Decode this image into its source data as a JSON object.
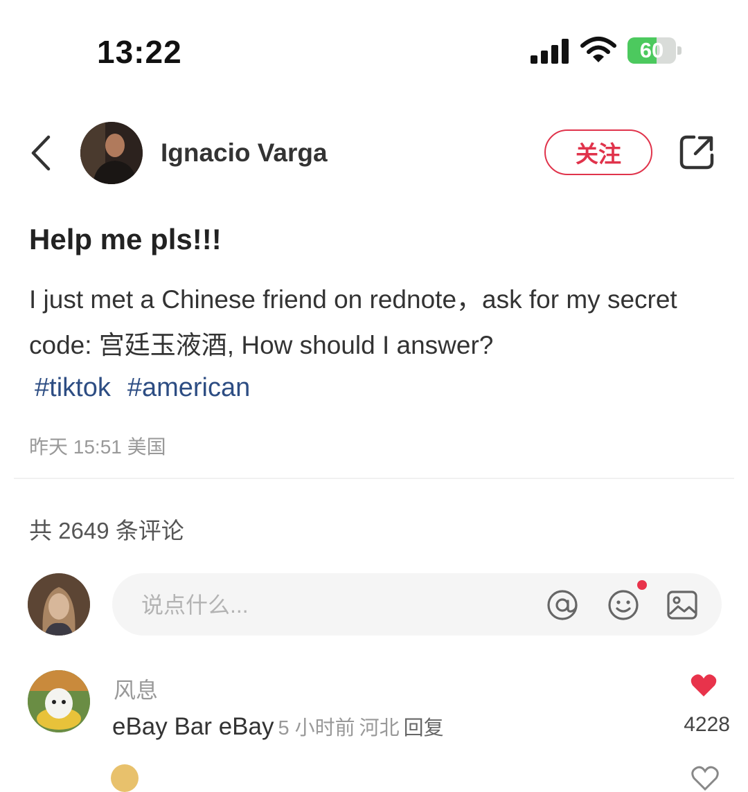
{
  "status_bar": {
    "time": "13:22",
    "battery_level": "60",
    "battery_fraction": 0.6,
    "battery_color": "#4cc95e"
  },
  "header": {
    "back_icon": "chevron-left-icon",
    "author_name": "Ignacio Varga",
    "follow_label": "关注",
    "share_icon": "share-icon"
  },
  "note": {
    "title": "Help me pls!!!",
    "body": "I just met a Chinese friend on rednote，ask for my secret code: 宫廷玉液酒, How should I answer?",
    "tags": [
      "#tiktok",
      "#american"
    ],
    "meta": "昨天 15:51 美国"
  },
  "comments": {
    "count_label": "共 2649 条评论",
    "input_placeholder": "说点什么...",
    "input_icons": [
      "at-icon",
      "emoji-icon",
      "image-icon"
    ],
    "items": [
      {
        "author": "风息",
        "text": "eBay Bar eBay",
        "time": "5 小时前",
        "location": "河北",
        "reply_label": "回复",
        "likes": "4228"
      }
    ]
  },
  "colors": {
    "accent": "#e0334b",
    "tag": "#2d4d83",
    "muted": "#999999"
  }
}
